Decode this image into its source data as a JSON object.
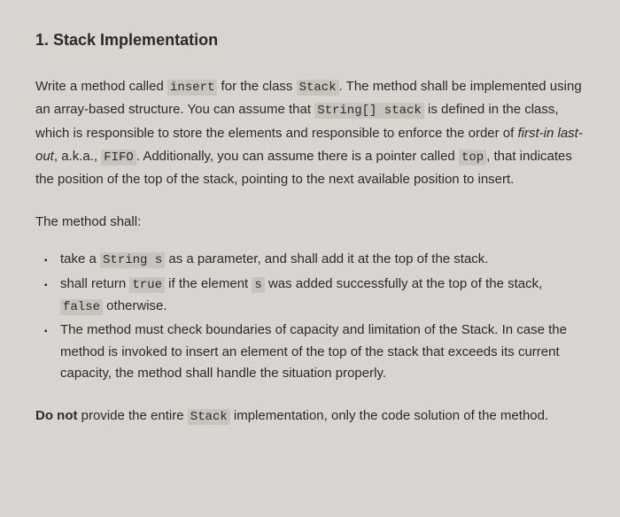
{
  "heading": "1. Stack Implementation",
  "p1_a": "Write a method called ",
  "p1_code1": "insert",
  "p1_b": " for the class ",
  "p1_code2": "Stack",
  "p1_c": ". The method shall be implemented using an array-based structure. You can assume that ",
  "p1_code3": "String[] stack",
  "p1_d": " is defined in the class, which is responsible to store the elements and responsible to enforce the order of ",
  "p1_italic": "first-in last-out",
  "p1_e": ", a.k.a., ",
  "p1_code4": "FIFO",
  "p1_f": ". Additionally, you can assume there is a pointer called ",
  "p1_code5": "top",
  "p1_g": ", that indicates the position of the top of the stack, pointing to the next available position to insert.",
  "subheading": "The method shall:",
  "li1_a": "take a ",
  "li1_code1": "String s",
  "li1_b": " as a parameter, and shall add it at the top of the stack.",
  "li2_a": "shall return ",
  "li2_code1": "true",
  "li2_b": " if the element ",
  "li2_code2": "s",
  "li2_c": " was added successfully at the top of the stack, ",
  "li2_code3": "false",
  "li2_d": " otherwise.",
  "li3": "The method must check boundaries of capacity and limitation of the Stack. In case the method is invoked to insert an element of the top of the stack that exceeds its current capacity, the method shall handle the situation properly.",
  "footer_bold": "Do not",
  "footer_a": " provide the entire ",
  "footer_code": "Stack",
  "footer_b": " implementation, only the code solution of the method."
}
